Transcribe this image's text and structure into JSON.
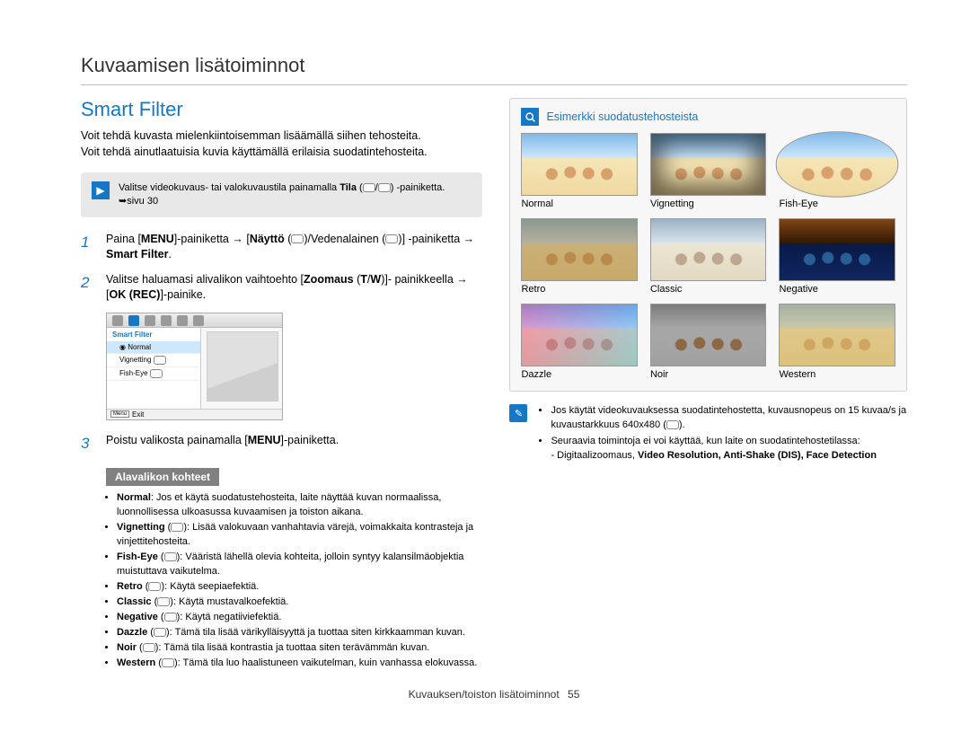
{
  "page": {
    "title": "Kuvaamisen lisätoiminnot",
    "section_title": "Smart Filter",
    "intro1": "Voit tehdä kuvasta mielenkiintoisemman lisäämällä siihen tehosteita.",
    "intro2": "Voit tehdä ainutlaatuisia kuvia käyttämällä erilaisia suodatintehosteita."
  },
  "tip": {
    "text_before": "Valitse videokuvaus- tai valokuvaustila painamalla",
    "tila_label": "Tila",
    "text_after": "-painiketta. ➥sivu 30"
  },
  "steps": [
    {
      "num": "1",
      "parts": {
        "a": "Paina [",
        "b": "MENU",
        "c": "]-painiketta → [",
        "d": "Näyttö",
        "e": " (",
        "f": ")/Vedenalainen (",
        "g": ")]",
        "h": "-painiketta → ",
        "i": "Smart Filter",
        "j": "."
      }
    },
    {
      "num": "2",
      "parts": {
        "a": "Valitse haluamasi alivalikon vaihtoehto [",
        "b": "Zoomaus",
        "c": " (",
        "d": "T",
        "e": "/",
        "f": "W",
        "g": ")]- painikkeella → [",
        "h": "OK (REC)",
        "i": "]-painike."
      }
    },
    {
      "num": "3",
      "parts": {
        "a": "Poistu valikosta painamalla [",
        "b": "MENU",
        "c": "]-painiketta."
      }
    }
  ],
  "screenshot": {
    "header": "Smart Filter",
    "items": [
      "Normal",
      "Vignetting",
      "Fish-Eye"
    ],
    "menu_btn": "Menu",
    "exit": "Exit"
  },
  "subsection": {
    "header": "Alavalikon kohteet",
    "items": [
      {
        "name": "Normal",
        "desc": ": Jos et käytä suodatustehosteita, laite näyttää kuvan normaalissa, luonnollisessa ulkoasussa kuvaamisen ja toiston aikana."
      },
      {
        "name": "Vignetting",
        "chip": true,
        "desc": ": Lisää valokuvaan vanhahtavia värejä, voimakkaita kontrasteja ja vinjettitehosteita."
      },
      {
        "name": "Fish-Eye",
        "chip": true,
        "desc": ": Vääristä lähellä olevia kohteita, jolloin syntyy kalansilmäobjektia muistuttava vaikutelma."
      },
      {
        "name": "Retro",
        "chip": true,
        "desc": ": Käytä seepiaefektiä."
      },
      {
        "name": "Classic",
        "chip": true,
        "desc": ": Käytä mustavalkoefektiä."
      },
      {
        "name": "Negative",
        "chip": true,
        "desc": ": Käytä negatiiviefektiä."
      },
      {
        "name": "Dazzle",
        "chip": true,
        "desc": ": Tämä tila lisää värikylläisyyttä ja tuottaa siten kirkkaamman kuvan."
      },
      {
        "name": "Noir",
        "chip": true,
        "desc": ": Tämä tila lisää kontrastia ja tuottaa siten terävämmän kuvan."
      },
      {
        "name": "Western",
        "chip": true,
        "desc": ": Tämä tila luo haalistuneen vaikutelman, kuin vanhassa elokuvassa."
      }
    ]
  },
  "example": {
    "header": "Esimerkki suodatustehosteista",
    "thumbs": [
      {
        "label": "Normal",
        "cls": ""
      },
      {
        "label": "Vignetting",
        "cls": "filter-vig"
      },
      {
        "label": "Fish-Eye",
        "cls": "filter-fish"
      },
      {
        "label": "Retro",
        "cls": "filter-retro"
      },
      {
        "label": "Classic",
        "cls": "filter-classic"
      },
      {
        "label": "Negative",
        "cls": "filter-neg"
      },
      {
        "label": "Dazzle",
        "cls": "filter-dazzle"
      },
      {
        "label": "Noir",
        "cls": "filter-noir"
      },
      {
        "label": "Western",
        "cls": "filter-west"
      }
    ]
  },
  "notes": {
    "items": [
      {
        "text": "Jos käytät videokuvauksessa suodatintehostetta, kuvausnopeus on 15 kuvaa/s ja kuvaustarkkuus 640x480 (",
        "tail": ")."
      },
      {
        "text": "Seuraavia toimintoja ei voi käyttää, kun laite on suodatintehostetilassa:",
        "sub_prefix": "- Digitaalizoomaus, ",
        "sub_bold": "Video Resolution, Anti-Shake (DIS), Face Detection"
      }
    ]
  },
  "footer": {
    "text": "Kuvauksen/toiston lisätoiminnot",
    "page": "55"
  }
}
